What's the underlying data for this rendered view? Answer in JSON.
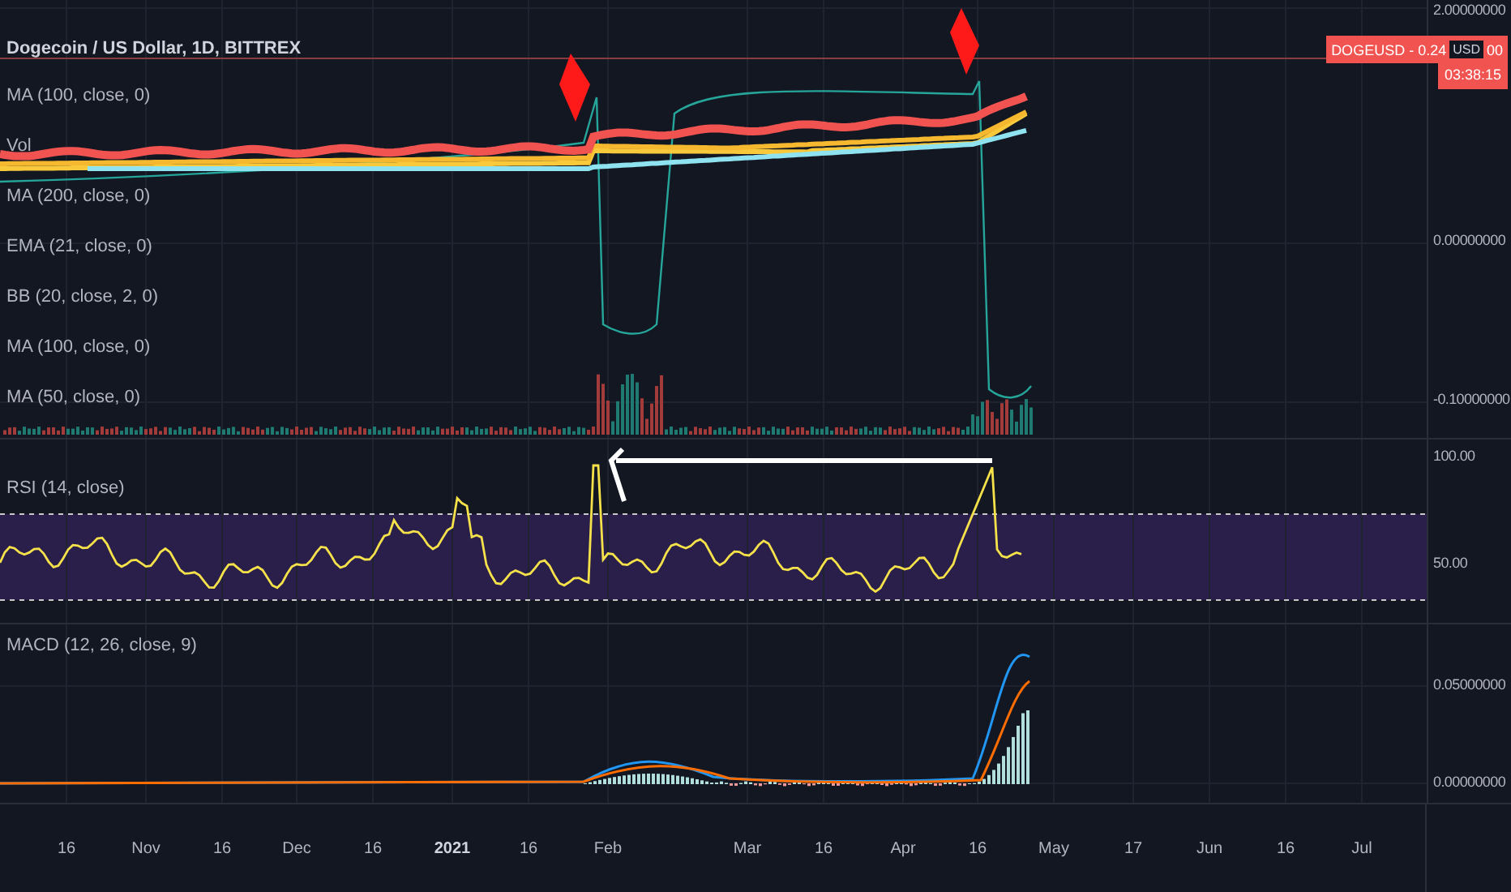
{
  "main_pane": {
    "title": "Dogecoin / US Dollar, 1D, BITTREX",
    "indicators": [
      "MA (100, close, 0)",
      "Vol",
      "MA (200, close, 0)",
      "EMA (21, close, 0)",
      "BB (20, close, 2, 0)",
      "MA (100, close, 0)",
      "MA (50, close, 0)"
    ],
    "price_axis": [
      "2.00000000",
      "0.00000000",
      "-0.10000000"
    ],
    "price_label": {
      "symbol_price": "DOGEUSD - 0.24",
      "currency": "USD",
      "price_end": "00",
      "countdown": "03:38:15"
    }
  },
  "rsi_pane": {
    "label": "RSI (14, close)",
    "axis": [
      "100.00",
      "50.00"
    ]
  },
  "macd_pane": {
    "label": "MACD (12, 26, close, 9)",
    "axis": [
      "0.05000000",
      "0.00000000"
    ]
  },
  "time_axis": [
    {
      "label": "16",
      "bold": false
    },
    {
      "label": "Nov",
      "bold": false
    },
    {
      "label": "16",
      "bold": false
    },
    {
      "label": "Dec",
      "bold": false
    },
    {
      "label": "16",
      "bold": false
    },
    {
      "label": "2021",
      "bold": true
    },
    {
      "label": "16",
      "bold": false
    },
    {
      "label": "Feb",
      "bold": false
    },
    {
      "label": "Mar",
      "bold": false
    },
    {
      "label": "16",
      "bold": false
    },
    {
      "label": "Apr",
      "bold": false
    },
    {
      "label": "16",
      "bold": false
    },
    {
      "label": "May",
      "bold": false
    },
    {
      "label": "17",
      "bold": false
    },
    {
      "label": "Jun",
      "bold": false
    },
    {
      "label": "16",
      "bold": false
    },
    {
      "label": "Jul",
      "bold": false
    }
  ]
}
